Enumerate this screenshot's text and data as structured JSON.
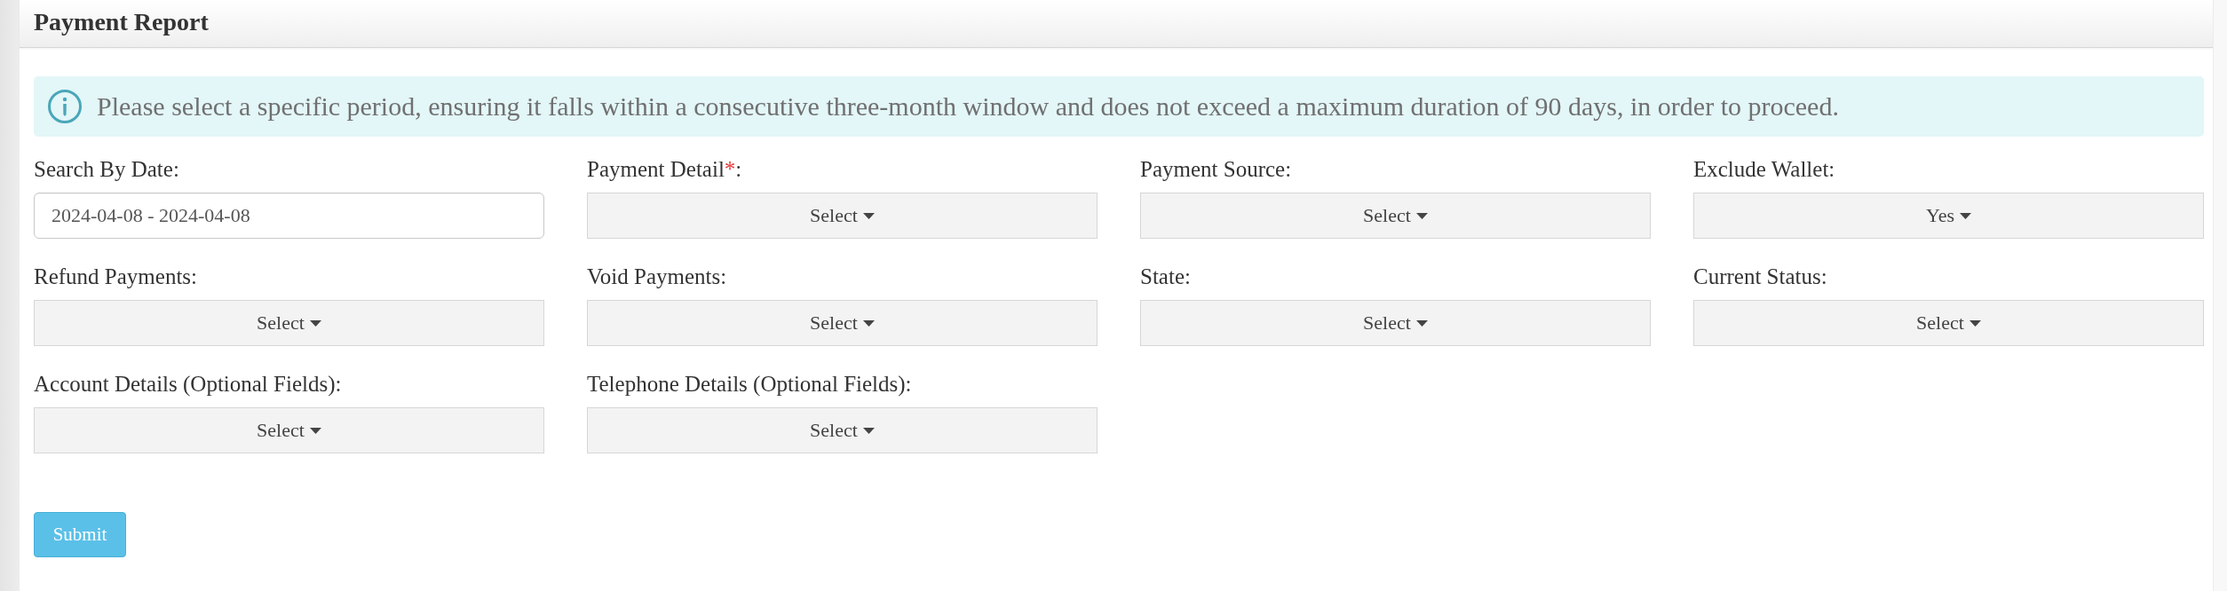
{
  "panel": {
    "title": "Payment Report"
  },
  "alert": {
    "kind": "info",
    "text": "Please select a specific period, ensuring it falls within a consecutive three-month window and does not exceed a maximum duration of 90 days, in order to proceed."
  },
  "fields": [
    {
      "kind": "date",
      "label": "Search By Date:",
      "value": "2024-04-08 - 2024-04-08"
    },
    {
      "kind": "dropdown",
      "label": "Payment Detail",
      "required_mark": "*",
      "label_suffix": ":",
      "value": "Select"
    },
    {
      "kind": "dropdown",
      "label": "Payment Source:",
      "value": "Select"
    },
    {
      "kind": "dropdown",
      "label": "Exclude Wallet:",
      "value": "Yes"
    },
    {
      "kind": "dropdown",
      "label": "Refund Payments:",
      "value": "Select"
    },
    {
      "kind": "dropdown",
      "label": "Void Payments:",
      "value": "Select"
    },
    {
      "kind": "dropdown",
      "label": "State:",
      "value": "Select"
    },
    {
      "kind": "dropdown",
      "label": "Current Status:",
      "value": "Select"
    },
    {
      "kind": "dropdown",
      "label": "Account Details (Optional Fields):",
      "value": "Select"
    },
    {
      "kind": "dropdown",
      "label": "Telephone Details (Optional Fields):",
      "value": "Select"
    }
  ],
  "submit": {
    "label": "Submit"
  }
}
